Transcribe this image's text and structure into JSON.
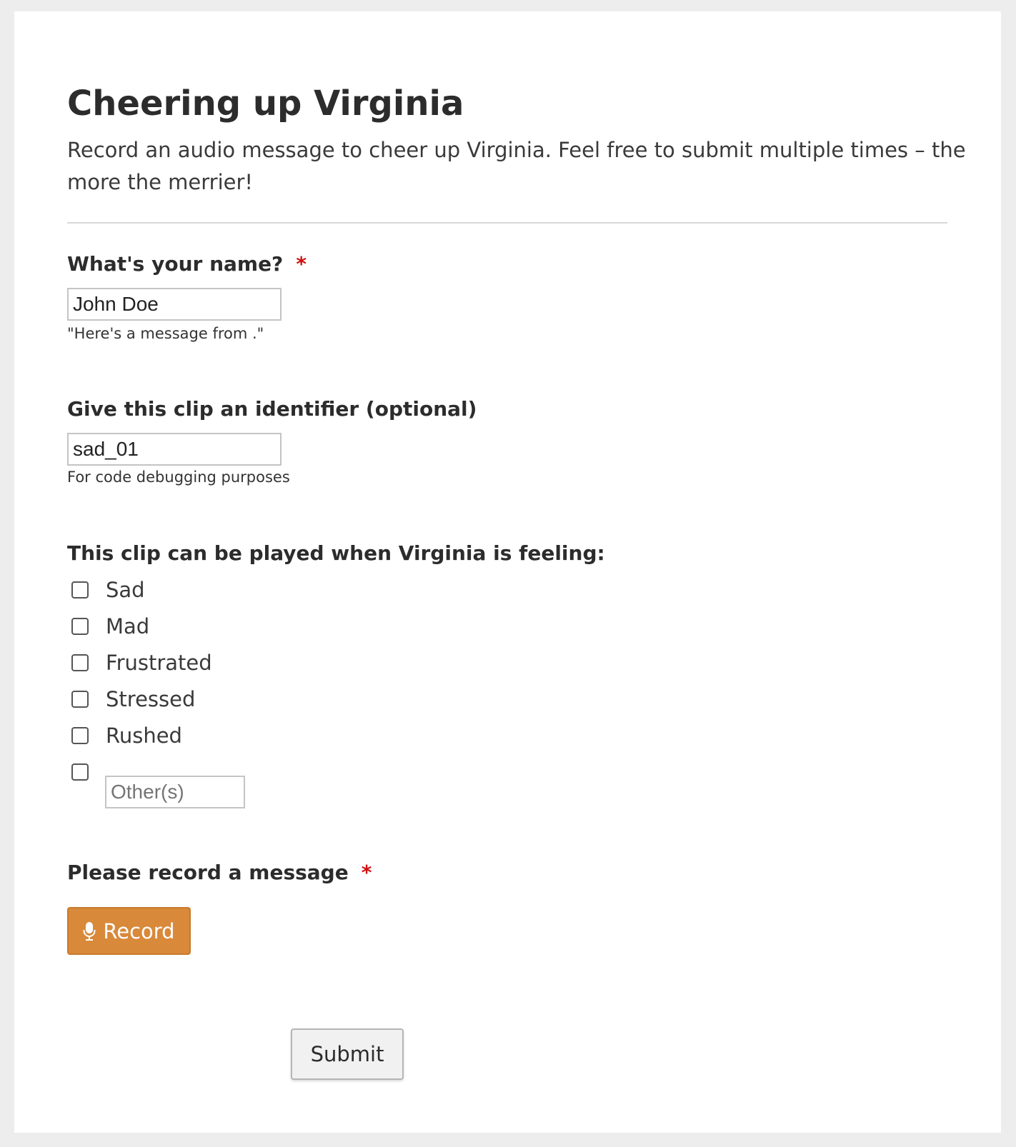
{
  "form": {
    "title": "Cheering up Virginia",
    "description": "Record an audio message to cheer up Virginia. Feel free to submit multiple times – the more the merrier!"
  },
  "name_field": {
    "label": "What's your name?",
    "required_mark": "*",
    "value": "John Doe",
    "hint": "\"Here's a message from .\""
  },
  "identifier_field": {
    "label": "Give this clip an identifier (optional)",
    "value": "sad_01",
    "hint": "For code debugging purposes"
  },
  "feelings": {
    "label": "This clip can be played when Virginia is feeling:",
    "options": [
      {
        "label": "Sad",
        "checked": false
      },
      {
        "label": "Mad",
        "checked": false
      },
      {
        "label": "Frustrated",
        "checked": false
      },
      {
        "label": "Stressed",
        "checked": false
      },
      {
        "label": "Rushed",
        "checked": false
      }
    ],
    "other": {
      "placeholder": "Other(s)",
      "checked": false
    }
  },
  "record": {
    "label": "Please record a message",
    "required_mark": "*",
    "button_label": "Record",
    "button_icon": "microphone-icon",
    "button_color": "#d9893a"
  },
  "submit": {
    "label": "Submit"
  }
}
